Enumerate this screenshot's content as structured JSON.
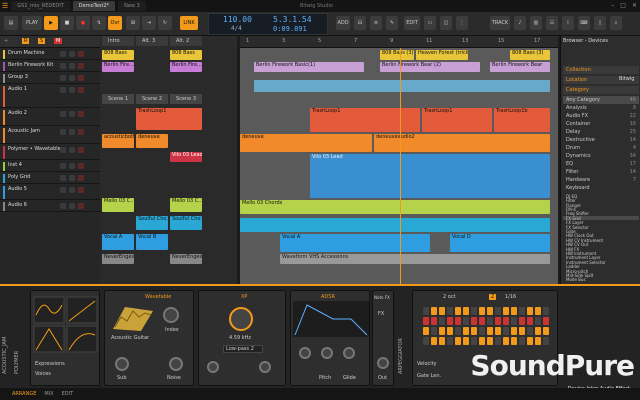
{
  "tabs": [
    "GS1_mix_REDEDIT",
    "DemoTest2*",
    "New 3"
  ],
  "window": {
    "title": "Bitwig Studio"
  },
  "toolbar": {
    "play": "PLAY",
    "ovr": "Ovr",
    "link": "LINK",
    "tempo": "110.00",
    "signature": "4/4",
    "position": "5.3.1.54",
    "time": "0:09.891",
    "add": "ADD",
    "edit": "EDIT",
    "track": "TRACK"
  },
  "tracks": [
    {
      "name": "Drum Machine",
      "color": "#e9c53a"
    },
    {
      "name": "Berlin Firework Kit",
      "color": "#9b59b6"
    },
    {
      "name": "Group 3",
      "color": "#8f8f8f"
    },
    {
      "name": "Audio 1",
      "color": "#e35b3b"
    },
    {
      "name": "Audio 2",
      "color": "#f08a2a"
    },
    {
      "name": "Acoustic Jam",
      "color": "#f08a2a"
    },
    {
      "name": "Polymer • Wavetable",
      "color": "#cc3344"
    },
    {
      "name": "Inst 4",
      "color": "#9acd32"
    },
    {
      "name": "Poly Grid",
      "color": "#29a8d6"
    },
    {
      "name": "Audio 5",
      "color": "#2f9ee0"
    },
    {
      "name": "Audio 6",
      "color": "#888888"
    }
  ],
  "scenes": [
    "Intro",
    "Alt. 3",
    "Alt. 2",
    "Scene 1",
    "Scene 2",
    "Scene 3"
  ],
  "clips": {
    "c1": "808 Bass",
    "c2": "808 Bass",
    "c3": "Berlin Fire...",
    "c4": "Berlin Fire...",
    "c5": "TrashLoop1",
    "c6": "acousticbottl",
    "c7": "deneuve",
    "c8": "Vilo 03 Lead",
    "c9": "Mello 03 C...",
    "c10": "Mello 03 C...",
    "c11": "Soulful Cho...",
    "c12": "Soulful Cho...",
    "c13": "Vocal A",
    "c14": "Vocal B",
    "c15": "NeverEnges",
    "c16": "NeverEnges"
  },
  "arrange": {
    "ruler": [
      "1",
      "3",
      "5",
      "7",
      "9",
      "11",
      "13",
      "15",
      "17"
    ],
    "c1": "808 Bass (3)",
    "c2": "Heaven Forest (trick)",
    "c3": "808 Bass (3)",
    "c4": "Berlin Firework Basic(1)",
    "c5": "Berlin Firework Bear (2)",
    "c6": "Berlin Firework Bear",
    "c7": "TrashLoop1",
    "c8": "TrashLoop1",
    "c9": "TrashLoop1b",
    "c10": "deneuve",
    "c11": "deneuveaudio2",
    "c12": "Vilo 03 Lead",
    "c13": "Mello 03 Chords",
    "c14": "Vocal A",
    "c15": "Vocal D",
    "c16": "Waveform VHS Accessions"
  },
  "browser": {
    "title": "Browser - Devices",
    "sections": [
      "Collection",
      "Location",
      "Category"
    ],
    "location_value": "Bitwig",
    "categories": [
      "Any Category",
      "Analysis",
      "Audio FX",
      "Container",
      "Delay",
      "Destructive",
      "Drum",
      "Dynamics",
      "EQ",
      "Filter",
      "Hardware",
      "Keyboard"
    ],
    "devices": [
      "DJ EQ",
      "Filter",
      "Flanger",
      "FM-4",
      "Freq Shifter",
      "FX Grid",
      "FX Layer",
      "FX Selector",
      "Gate",
      "HW Clock Out",
      "HW CV Instrument",
      "HW CV Out",
      "HW FX",
      "HW Instrument",
      "Instrument Layer",
      "Instrument Selector",
      "Ladder",
      "Micro-pitch",
      "Mid-Side Split",
      "Mode Bus"
    ],
    "counts": [
      "46",
      "8",
      "22",
      "16",
      "25",
      "14",
      "4",
      "34",
      "17",
      "14",
      "7"
    ]
  },
  "device": {
    "track_label": "ACOUSTIC_JAM",
    "polymer": "POLYMER",
    "wavetable": "Wavetable",
    "osc": "Acoustic Guitar",
    "index": "Index",
    "sub": "Sub",
    "noise": "Noise",
    "xp": "XP",
    "adsr": "ADSR",
    "freq": "4.59 kHz",
    "filter": "Low-pass 2",
    "pitch": "Pitch",
    "glide": "Glide",
    "out": "Out",
    "note_fx": "Note FX",
    "fx": "FX",
    "arp": "ARPEGGIATOR",
    "rate": "2 oct",
    "step": "1/16",
    "gate": "Gate Len.",
    "velocity": "Velocity",
    "expressions": "Expressions",
    "voices": "Voices"
  },
  "status": {
    "arrange": "ARRANGE",
    "mix": "MIX",
    "edit": "EDIT"
  },
  "logo": {
    "name": "SoundPure",
    "sub": "Device Inter Audio Effect"
  }
}
